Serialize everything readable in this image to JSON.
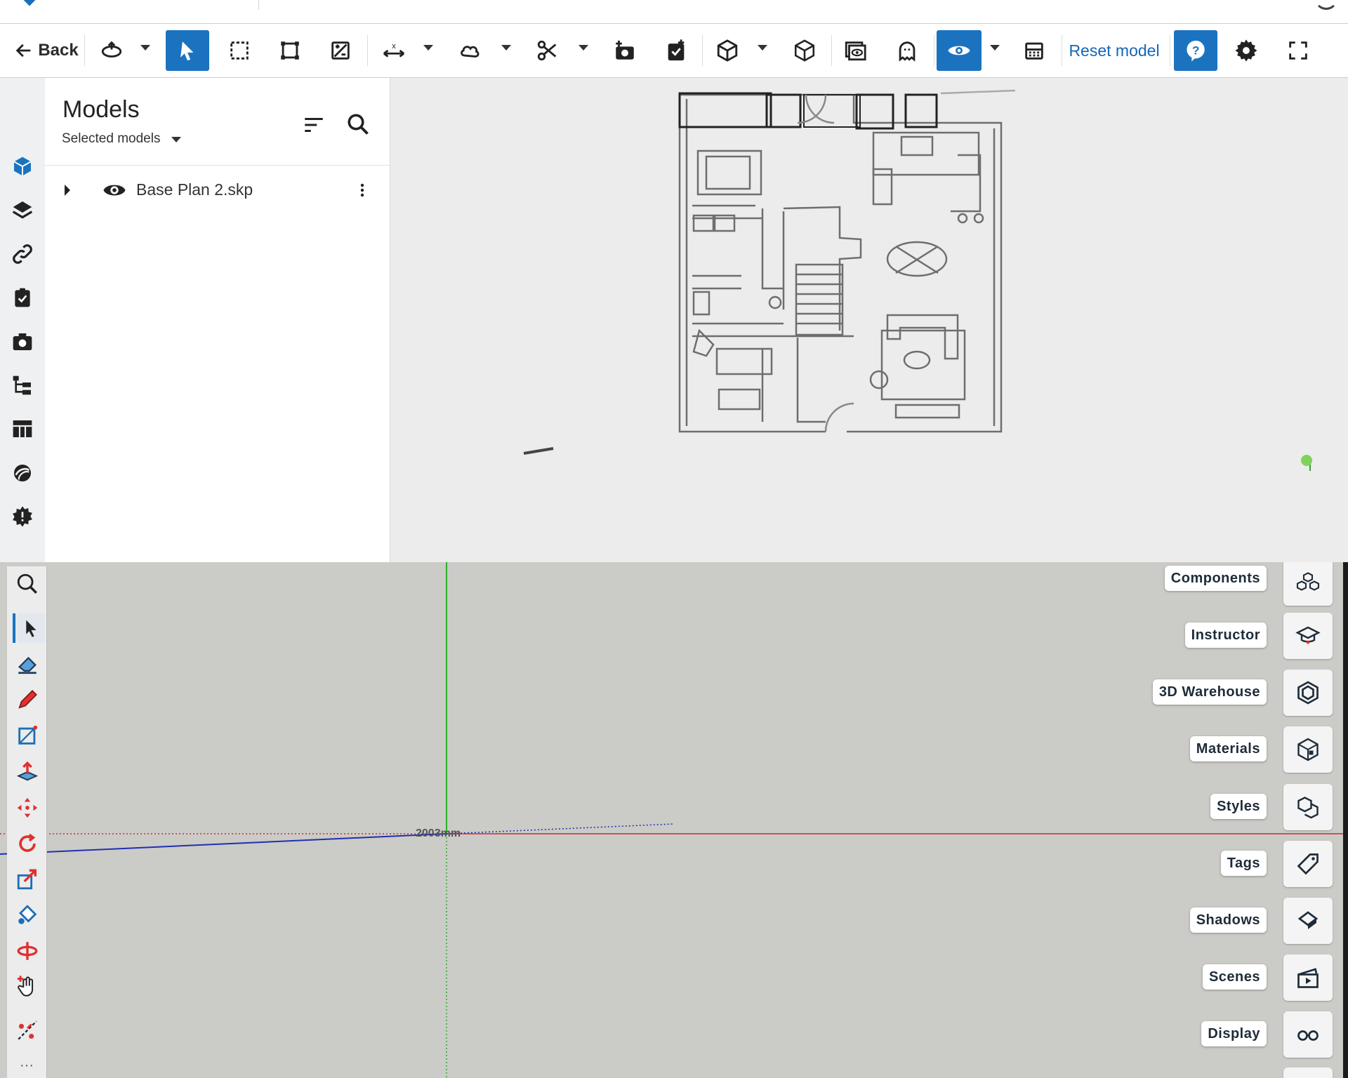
{
  "toolbar": {
    "back_label": "Back",
    "reset_label": "Reset model",
    "colors": {
      "accent": "#1b73c0",
      "reset_text": "#1466b8"
    }
  },
  "models_panel": {
    "title": "Models",
    "filter_label": "Selected models",
    "items": [
      {
        "name": "Base Plan 2.skp",
        "visible": true
      }
    ]
  },
  "left_rail_icons": [
    "models-cube-icon",
    "layers-icon",
    "link-icon",
    "clipboard-check-icon",
    "camera-icon",
    "hierarchy-icon",
    "table-icon",
    "sphere-icon",
    "issues-badge-icon"
  ],
  "sketchup": {
    "dimension_text": "2003mm",
    "tools": [
      "zoom-icon",
      "select-icon",
      "eraser-icon",
      "pencil-icon",
      "rectangle-icon",
      "push-pull-icon",
      "move-icon",
      "rotate-icon",
      "scale-icon",
      "paint-bucket-icon",
      "orbit-icon",
      "pan-icon",
      "tape-measure-icon"
    ],
    "panels": [
      {
        "label": "Components",
        "icon": "components-icon"
      },
      {
        "label": "Instructor",
        "icon": "instructor-icon"
      },
      {
        "label": "3D Warehouse",
        "icon": "warehouse-icon"
      },
      {
        "label": "Materials",
        "icon": "materials-icon"
      },
      {
        "label": "Styles",
        "icon": "styles-icon"
      },
      {
        "label": "Tags",
        "icon": "tags-icon"
      },
      {
        "label": "Shadows",
        "icon": "shadows-icon"
      },
      {
        "label": "Scenes",
        "icon": "scenes-icon"
      },
      {
        "label": "Display",
        "icon": "display-icon"
      }
    ],
    "colors": {
      "x_axis": "#d22b2b",
      "y_axis": "#2bb02b",
      "z_axis": "#2030b0",
      "background": "#cbcbc7"
    }
  }
}
